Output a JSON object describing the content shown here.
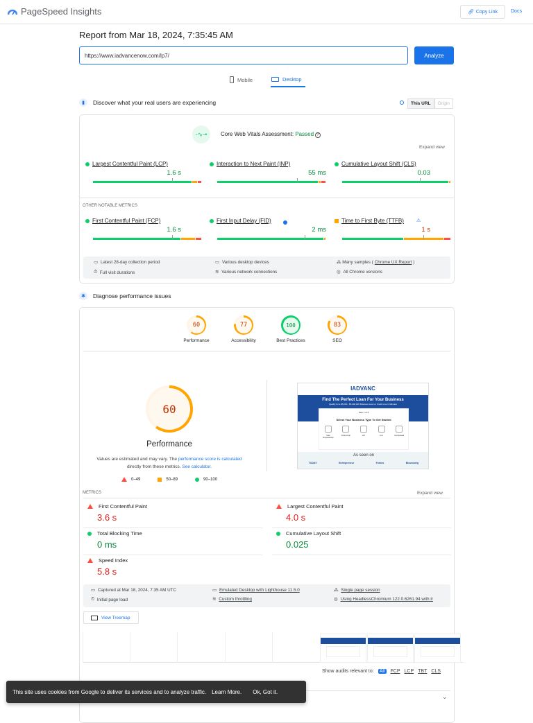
{
  "header": {
    "app_title": "PageSpeed Insights",
    "copy_link": "Copy Link",
    "docs": "Docs"
  },
  "report": {
    "title": "Report from Mar 18, 2024, 7:35:45 AM",
    "url": "https://www.iadvancenow.com/lp7/",
    "analyze": "Analyze"
  },
  "tabs": [
    {
      "label": "Mobile"
    },
    {
      "label": "Desktop",
      "active": true
    }
  ],
  "field": {
    "heading": "Discover what your real users are experiencing",
    "toggle": {
      "this_url": "This URL",
      "origin": "Origin"
    },
    "assessment_label": "Core Web Vitals Assessment:",
    "assessment_status": "Passed",
    "expand": "Expand view",
    "other_heading": "OTHER NOTABLE METRICS",
    "core": [
      {
        "name": "Largest Contentful Paint (LCP)",
        "value": "1.6 s",
        "status": "good",
        "dist": [
          92,
          5,
          3
        ],
        "marker": 73
      },
      {
        "name": "Interaction to Next Paint (INP)",
        "value": "55 ms",
        "status": "good",
        "dist": [
          94,
          2,
          4
        ],
        "marker": 74
      },
      {
        "name": "Cumulative Layout Shift (CLS)",
        "value": "0.03",
        "status": "good",
        "dist": [
          99,
          1,
          0
        ],
        "marker": 72
      }
    ],
    "other": [
      {
        "name": "First Contentful Paint (FCP)",
        "value": "1.6 s",
        "status": "good",
        "dist": [
          82,
          13,
          5
        ],
        "marker": 73
      },
      {
        "name": "First Input Delay (FID)",
        "value": "2 ms",
        "status": "good",
        "dist": [
          99,
          1,
          0
        ],
        "marker": 81
      },
      {
        "name": "Time to First Byte (TTFB)",
        "value": "1 s",
        "status": "average",
        "dist": [
          57,
          37,
          6
        ],
        "marker": 75
      }
    ],
    "info": [
      "Latest 28-day collection period",
      "Various desktop devices",
      "Many samples (",
      "Chrome UX Report",
      ")",
      "Full visit durations",
      "Various network connections",
      "All Chrome versions"
    ]
  },
  "lab": {
    "heading": "Diagnose performance issues",
    "scores": [
      {
        "label": "Performance",
        "value": "60",
        "color": "#ffa400"
      },
      {
        "label": "Accessibility",
        "value": "77",
        "color": "#ffa400"
      },
      {
        "label": "Best Practices",
        "value": "100",
        "color": "#0cce6b"
      },
      {
        "label": "SEO",
        "value": "83",
        "color": "#ffa400"
      }
    ],
    "big_score": "60",
    "big_label": "Performance",
    "note1": "Values are estimated and may vary. The ",
    "note_link1": "performance score is calculated",
    "note2": "directly from these metrics. ",
    "note_link2": "See calculator.",
    "legend": [
      "0–49",
      "50–89",
      "90–100"
    ],
    "screenshot": {
      "brand": "IADVANC",
      "headline": "Find The Perfect Loan For Your Business",
      "sub": "Qualify for a $5,000 - $5,000,000 Business Loan or Credit Line in Minutes",
      "step": "Step 1 of 5",
      "question": "Select Your Business Type To Get Started",
      "options": [
        "Sole Proprietorship",
        "Partnership",
        "LLP",
        "LLC",
        "Incorporated"
      ],
      "as_seen": "As seen on",
      "press": [
        "TODAY",
        "Entrepreneur",
        "Forbes",
        "Bloomberg"
      ]
    },
    "metrics_heading": "METRICS",
    "expand": "Expand view",
    "metrics": [
      {
        "name": "First Contentful Paint",
        "value": "3.6 s",
        "status": "poor"
      },
      {
        "name": "Largest Contentful Paint",
        "value": "4.0 s",
        "status": "poor"
      },
      {
        "name": "Total Blocking Time",
        "value": "0 ms",
        "status": "good"
      },
      {
        "name": "Cumulative Layout Shift",
        "value": "0.025",
        "status": "good"
      },
      {
        "name": "Speed Index",
        "value": "5.8 s",
        "status": "poor"
      }
    ],
    "info": [
      "Captured at Mar 18, 2024, 7:35 AM UTC",
      "Emulated Desktop with Lighthouse 11.5.0",
      "Single page session",
      "Initial page load",
      "Custom throttling",
      "Using HeadlessChromium 122.0.6261.94 with lr"
    ],
    "treemap": "View Treemap",
    "audits_label": "Show audits relevant to:",
    "audit_filters": [
      "All",
      "FCP",
      "LCP",
      "TBT",
      "CLS"
    ]
  },
  "cookie": {
    "text": "This site uses cookies from Google to deliver its services and to analyze traffic.",
    "learn": "Learn More.",
    "ok": "Ok, Got it."
  }
}
